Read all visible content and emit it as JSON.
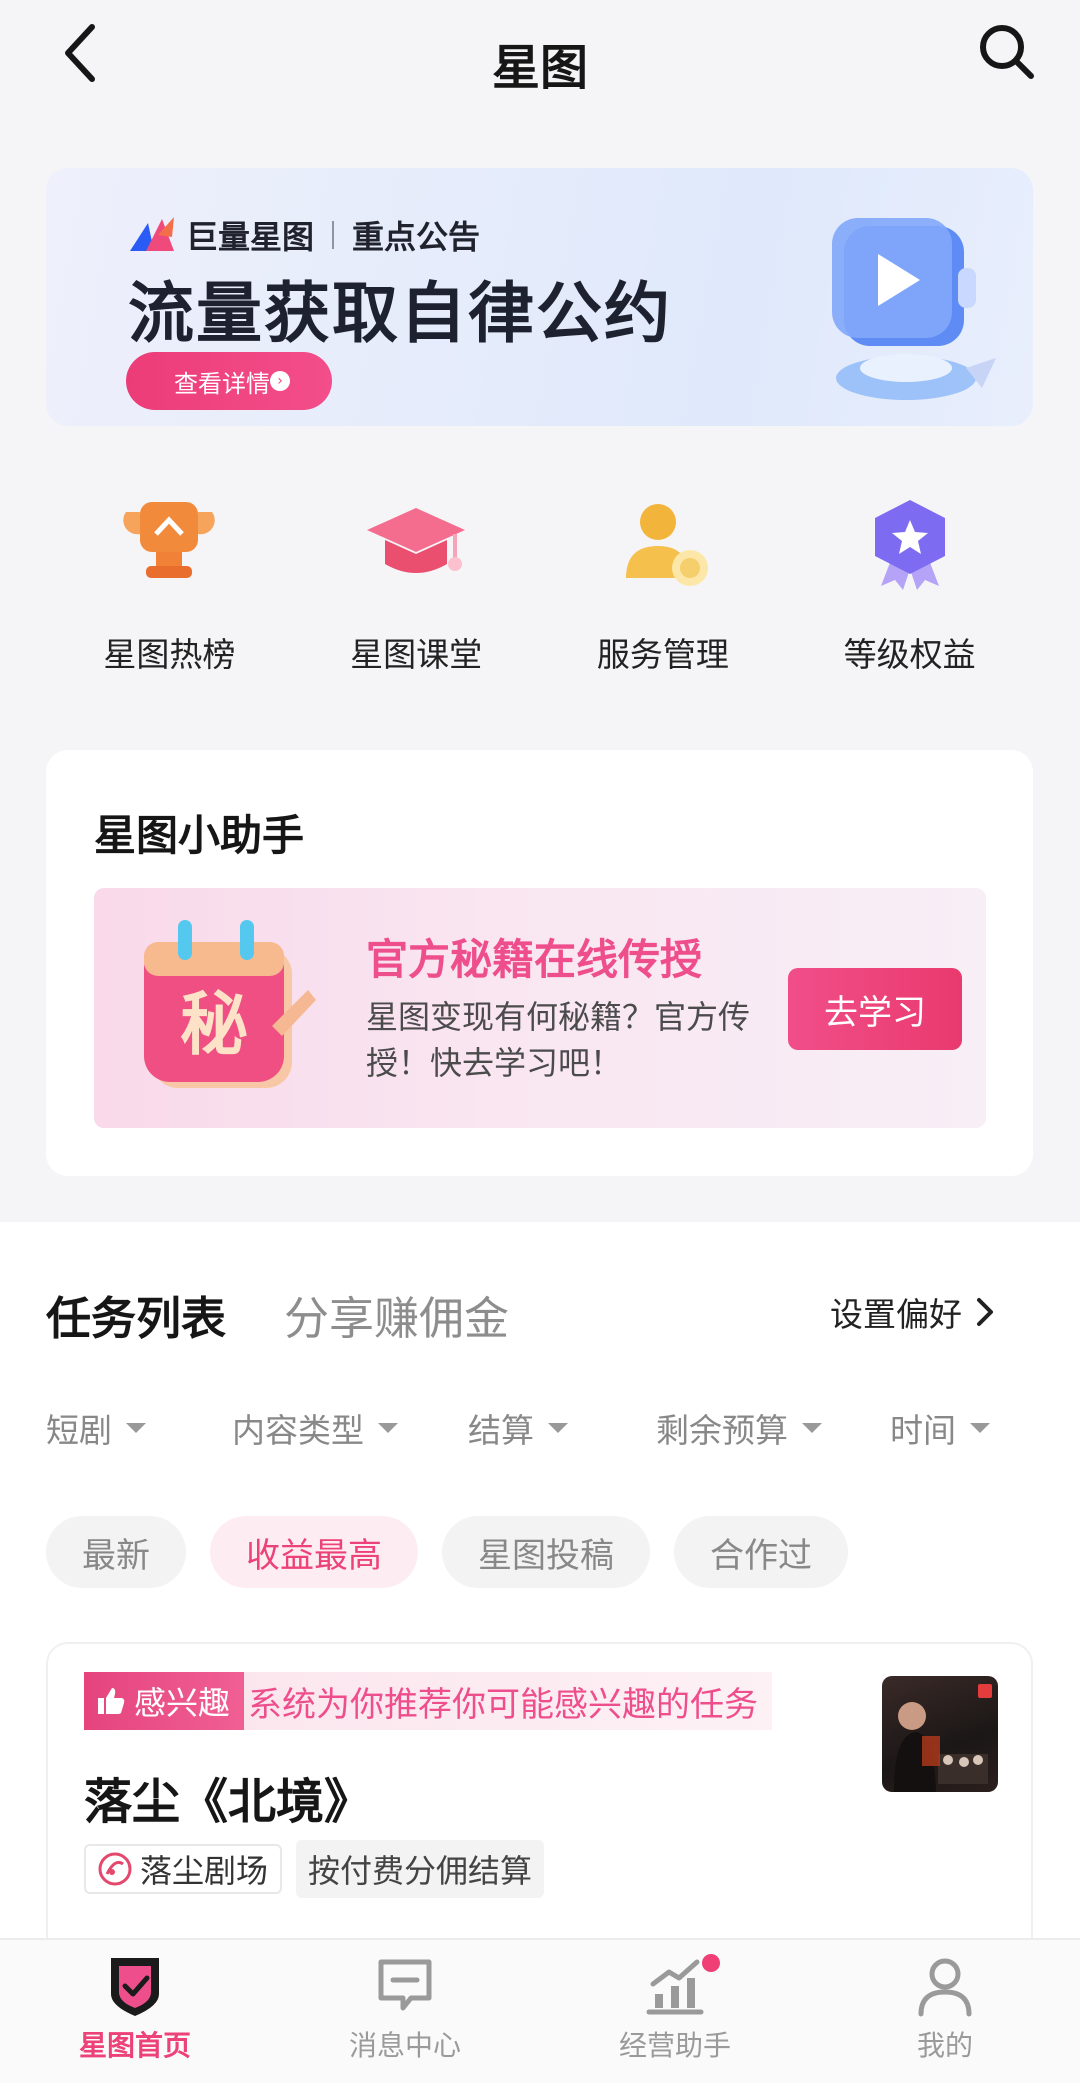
{
  "header": {
    "title": "星图"
  },
  "banner": {
    "brand": "巨量星图",
    "tag": "重点公告",
    "headline": "流量获取自律公约",
    "cta": "查看详情"
  },
  "quick_entries": [
    {
      "label": "星图热榜",
      "icon": "trophy-icon"
    },
    {
      "label": "星图课堂",
      "icon": "graduation-cap-icon"
    },
    {
      "label": "服务管理",
      "icon": "person-coin-icon"
    },
    {
      "label": "等级权益",
      "icon": "medal-star-icon"
    }
  ],
  "assistant": {
    "title": "星图小助手",
    "promo_badge_char": "秘",
    "promo_title": "官方秘籍在线传授",
    "promo_desc": "星图变现有何秘籍？官方传授！快去学习吧！",
    "promo_button": "去学习"
  },
  "task_section": {
    "tabs": [
      {
        "label": "任务列表",
        "active": true
      },
      {
        "label": "分享赚佣金",
        "active": false
      }
    ],
    "preference": "设置偏好",
    "filters": [
      "短剧",
      "内容类型",
      "结算",
      "剩余预算",
      "时间"
    ],
    "sort_chips": [
      {
        "label": "最新",
        "selected": false
      },
      {
        "label": "收益最高",
        "selected": true
      },
      {
        "label": "星图投稿",
        "selected": false
      },
      {
        "label": "合作过",
        "selected": false
      }
    ],
    "task": {
      "interest_tag": "感兴趣",
      "interest_text": "系统为你推荐你可能感兴趣的任务",
      "title": "落尘《北境》",
      "source": "落尘剧场",
      "settlement": "按付费分佣结算"
    }
  },
  "tabbar": {
    "items": [
      {
        "label": "星图首页",
        "icon": "shield-check-icon",
        "active": true
      },
      {
        "label": "消息中心",
        "icon": "message-icon",
        "active": false
      },
      {
        "label": "经营助手",
        "icon": "chart-icon",
        "active": false,
        "has_dot": true
      },
      {
        "label": "我的",
        "icon": "user-icon",
        "active": false
      }
    ]
  },
  "colors": {
    "accent": "#ec4279",
    "text": "#161616",
    "muted": "#8d8d8d"
  }
}
